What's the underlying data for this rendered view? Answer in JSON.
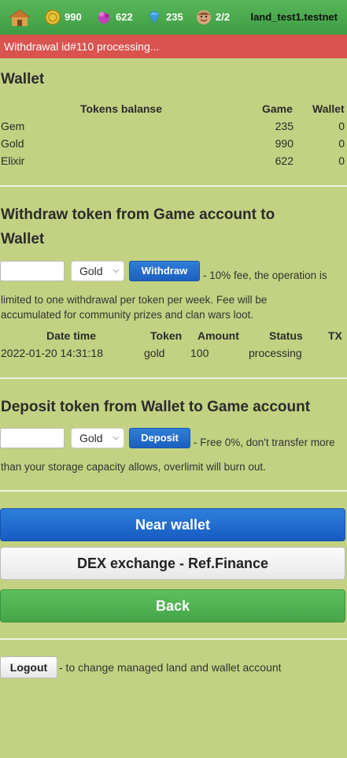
{
  "header": {
    "home_icon": "house-icon",
    "resources": [
      {
        "icon": "gold-coin-icon",
        "value": "990"
      },
      {
        "icon": "elixir-icon",
        "value": "622"
      },
      {
        "icon": "gem-icon",
        "value": "235"
      },
      {
        "icon": "worker-icon",
        "value": "2/2"
      }
    ],
    "account": "land_test1.testnet"
  },
  "alert": {
    "text": "Withdrawal id#110 processing...",
    "color": "#d9534f"
  },
  "wallet": {
    "title": "Wallet",
    "columns": [
      "Tokens balanse",
      "Game",
      "Wallet"
    ],
    "rows": [
      {
        "token": "Gem",
        "game": "235",
        "wallet": "0"
      },
      {
        "token": "Gold",
        "game": "990",
        "wallet": "0"
      },
      {
        "token": "Elixir",
        "game": "622",
        "wallet": "0"
      }
    ]
  },
  "withdraw": {
    "title_line1": "Withdraw token from Game account to",
    "title_line2": "Wallet",
    "amount_value": "",
    "token_selected": "Gold",
    "button": "Withdraw",
    "note_line1": "- 10% fee, the operation is",
    "note_line2": "limited to one withdrawal per token per week. Fee will be",
    "note_line3": "accumulated for community prizes and clan wars loot.",
    "history_columns": [
      "Date time",
      "Token",
      "Amount",
      "Status",
      "TX"
    ],
    "history": [
      {
        "datetime": "2022-01-20 14:31:18",
        "token": "gold",
        "amount": "100",
        "status": "processing",
        "tx": ""
      }
    ]
  },
  "deposit": {
    "title": "Deposit token from Wallet to Game account",
    "amount_value": "",
    "token_selected": "Gold",
    "button": "Deposit",
    "note_line1": "- Free 0%, don't transfer more",
    "note_line2": "than your storage capacity allows, overlimit will burn out."
  },
  "actions": {
    "near_wallet": "Near wallet",
    "dex": "DEX exchange - Ref.Finance",
    "back": "Back"
  },
  "logout": {
    "button": "Logout",
    "note": "- to change managed land and wallet account"
  }
}
